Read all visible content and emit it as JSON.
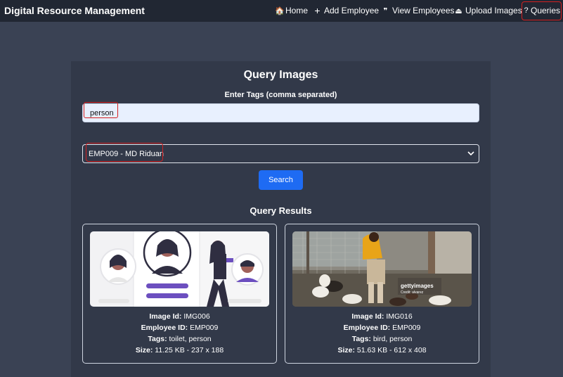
{
  "navbar": {
    "brand": "Digital Resource Management",
    "items": [
      {
        "label": "Home",
        "icon": "home-icon",
        "glyph": "🏠"
      },
      {
        "label": "Add Employee",
        "icon": "plus-icon",
        "glyph": "+"
      },
      {
        "label": "View Employees",
        "icon": "quote-icon",
        "glyph": "❞"
      },
      {
        "label": "Upload Images",
        "icon": "upload-icon",
        "glyph": "⏏"
      },
      {
        "label": "Queries",
        "icon": "question-icon",
        "glyph": "?"
      }
    ],
    "annotation_color": "#d42020"
  },
  "query": {
    "title": "Query Images",
    "tags_label": "Enter Tags (comma separated)",
    "tags_value": "person",
    "employee_selected": "EMP009 - MD Riduan",
    "search_label": "Search",
    "accent": "#1e6bf3"
  },
  "results": {
    "title": "Query Results",
    "field_labels": {
      "image_id": "Image Id:",
      "employee_id": "Employee ID:",
      "tags": "Tags:",
      "size": "Size:"
    },
    "items": [
      {
        "image_id": "IMG006",
        "employee_id": "EMP009",
        "tags": "toilet, person",
        "size": "11.25 KB - 237 x 188"
      },
      {
        "image_id": "IMG016",
        "employee_id": "EMP009",
        "tags": "bird, person",
        "size": "51.63 KB - 612 x 408",
        "watermark": "gettyimages",
        "credit": "Credit: alvarez"
      }
    ]
  }
}
